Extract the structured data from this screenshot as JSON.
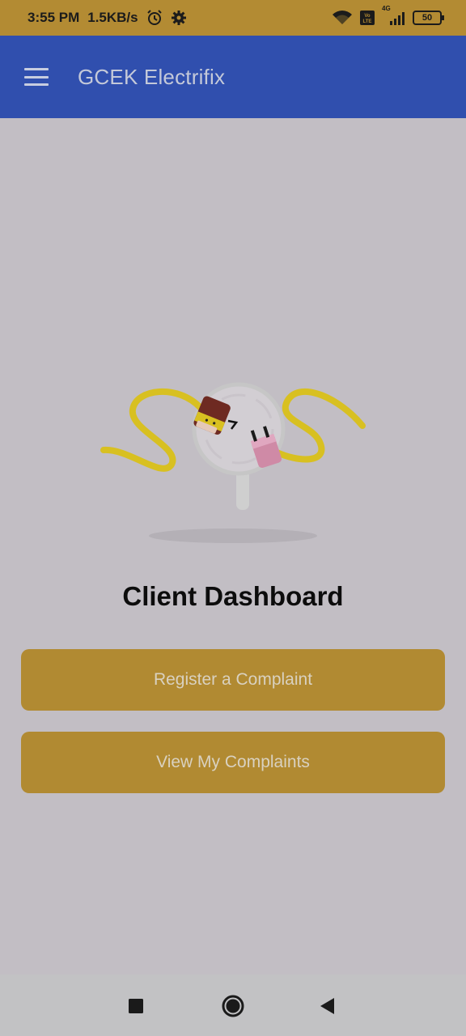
{
  "status_bar": {
    "time": "3:55 PM",
    "speed": "1.5KB/s",
    "network": "4G",
    "battery": "50",
    "icons": [
      "alarm-icon",
      "settings-gear-icon",
      "wifi-icon",
      "volte-icon",
      "signal-icon",
      "battery-icon"
    ]
  },
  "app_bar": {
    "title": "GCEK Electrifix",
    "menu_icon": "hamburger-menu-icon"
  },
  "illustration": {
    "description_icon": "disconnected-plug-icon",
    "colors": {
      "cable": "#d8c021",
      "socket": "#6e2a22",
      "plug": "#cf8aa6"
    }
  },
  "main": {
    "title": "Client Dashboard",
    "buttons": [
      {
        "label": "Register a Complaint"
      },
      {
        "label": "View My Complaints"
      }
    ]
  },
  "nav_bar": {
    "icons": [
      "recents-square-icon",
      "home-circle-icon",
      "back-triangle-icon"
    ]
  },
  "colors": {
    "status_bar": "#b38b33",
    "app_bar": "#304fae",
    "background": "#c2bec4",
    "button": "#b18a32"
  }
}
